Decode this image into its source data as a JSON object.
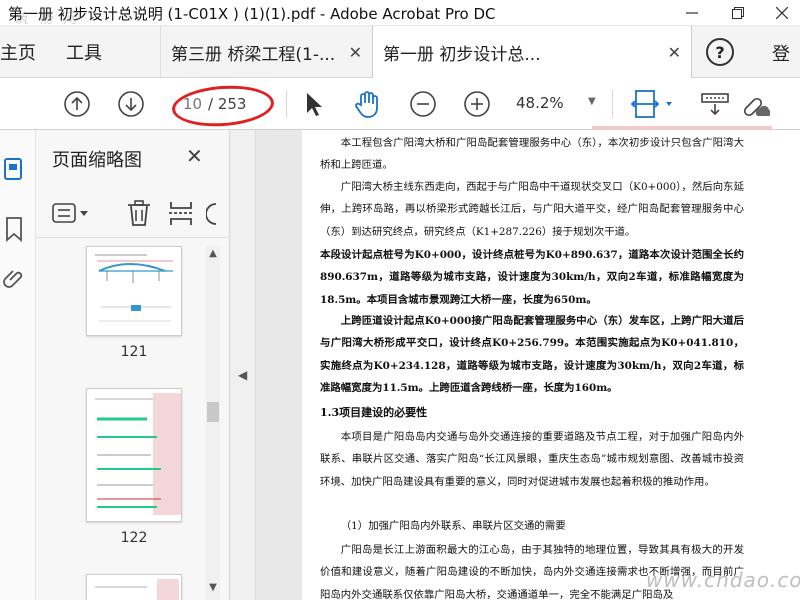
{
  "window": {
    "title": "第一册  初步设计总说明 (1-C01X  ) (1)(1).pdf - Adobe Acrobat Pro DC",
    "watermark_top": "筑 杨 网"
  },
  "nav": {
    "home": "主页",
    "tools": "工具"
  },
  "tabs": [
    {
      "label": "第三册 桥梁工程(1-..."
    },
    {
      "label": "第一册  初步设计总..."
    }
  ],
  "header": {
    "login": "登"
  },
  "toolbar": {
    "current_page": "10",
    "total_pages": "/ 253",
    "zoom": "48.2%"
  },
  "thumb_panel": {
    "title": "页面缩略图",
    "thumbnails": [
      {
        "label": "121"
      },
      {
        "label": "122"
      }
    ]
  },
  "document": {
    "paragraphs": [
      "本工程包含广阳湾大桥和广阳岛配套管理服务中心（东），本次初步设计只包含广阳湾大桥和上跨匝道。",
      "广阳湾大桥主线东西走向，西起于与广阳岛中干道现状交叉口（K0+000），然后向东延伸，上跨环岛路，再以桥梁形式跨越长江后，与广阳大道平交，经广阳岛配套管理服务中心（东）到达研究终点，研究终点（K1+287.226）接于规划次干道。",
      "本段设计起点桩号为K0+000，设计终点桩号为K0+890.637，道路本次设计范围全长约890.637m，道路等级为城市支路，设计速度为30km/h，双向2车道，标准路幅宽度为18.5m。本项目含城市景观跨江大桥一座，长度为650m。",
      "上跨匝道设计起点K0+000接广阳岛配套管理服务中心（东）发车区，上跨广阳大道后与广阳湾大桥形成平交口，设计终点K0+256.799。本范围实施起点为K0+041.810，实施终点为K0+234.128，道路等级为城市支路，设计速度为30km/h，双向2车道，标准路幅宽度为11.5m。上跨匝道含跨线桥一座，长度为160m。",
      "1.3项目建设的必要性",
      "本项目是广阳岛岛内交通与岛外交通连接的重要道路及节点工程，对于加强广阳岛内外联系、串联片区交通、落实广阳岛“长江风景眼，重庆生态岛”城市规划意图、改善城市投资环境、加快广阳岛建设具有重要的意义，同时对促进城市发展也起着积极的推动作用。",
      "（1）加强广阳岛内外联系、串联片区交通的需要",
      "广阳岛是长江上游面积最大的江心岛，由于其独特的地理位置，导致其具有极大的开发价值和建设意义，随着广阳岛建设的不断加快，岛内外交通连接需求也不断增强，而目前广阳岛内外交通联系仅依靠广阳岛大桥，交通通道单一，完全不能满足广阳岛及"
    ]
  },
  "watermark_bottom": "www.chdao.com"
}
